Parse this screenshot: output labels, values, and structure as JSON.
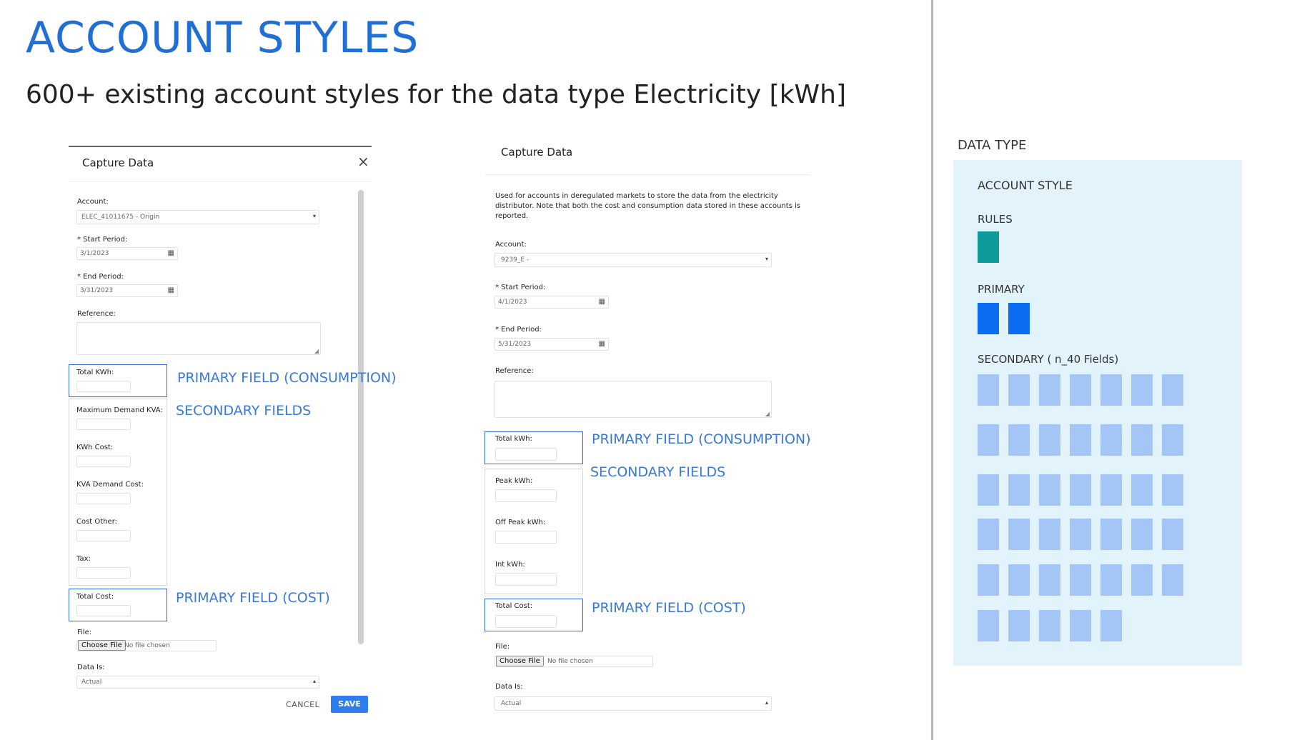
{
  "title": "ACCOUNT STYLES",
  "subtitle": "600+ existing account styles for the data type Electricity [kWh]",
  "left_form": {
    "header": "Capture Data",
    "close": "×",
    "account_label": "Account:",
    "account_value": "ELEC_41011675 - Origin",
    "start_label": "* Start Period:",
    "start_value": "3/1/2023",
    "end_label": "* End Period:",
    "end_value": "3/31/2023",
    "reference_label": "Reference:",
    "primary_field": "Total KWh:",
    "secondary_fields": [
      "Maximum Demand KVA:",
      "KWh Cost:",
      "KVA Demand Cost:",
      "Cost Other:",
      "Tax:"
    ],
    "total_cost_label": "Total Cost:",
    "file_label": "File:",
    "choose_file": "Choose File",
    "no_file": "No file chosen",
    "data_is_label": "Data Is:",
    "data_is_value": "Actual",
    "cancel": "CANCEL",
    "save": "SAVE"
  },
  "right_form": {
    "header": "Capture Data",
    "description": "Used for accounts in deregulated markets to store the data from the electricity distributor. Note that both the cost and consumption data stored in these accounts is reported.",
    "account_label": "Account:",
    "account_value": "9239_E -",
    "start_label": "* Start Period:",
    "start_value": "4/1/2023",
    "end_label": "* End Period:",
    "end_value": "5/31/2023",
    "reference_label": "Reference:",
    "primary_field": "Total kWh:",
    "secondary_fields": [
      "Peak kWh:",
      "Off Peak kWh:",
      "Int kWh:"
    ],
    "total_cost_label": "Total Cost:",
    "file_label": "File:",
    "choose_file": "Choose File",
    "no_file": "No file chosen",
    "data_is_label": "Data Is:",
    "data_is_value": "Actual"
  },
  "annotations": {
    "primary_consumption": "PRIMARY FIELD (CONSUMPTION)",
    "secondary": "SECONDARY FIELDS",
    "primary_cost": "PRIMARY FIELD (COST)"
  },
  "data_type_panel": {
    "heading": "DATA TYPE",
    "account_style": "ACCOUNT STYLE",
    "rules": "RULES",
    "primary": "PRIMARY",
    "secondary": "SECONDARY ( n_40 Fields)",
    "rules_count": 1,
    "primary_count": 2,
    "secondary_rows": [
      7,
      7,
      7,
      7,
      7,
      5
    ]
  },
  "colors": {
    "title": "#1f6fd6",
    "annotation": "#3a78d4",
    "panel_bg": "#e2f3fb",
    "rules_block": "#0e9a9a",
    "primary_block": "#0a6cf0",
    "secondary_block": "#a3c6f7",
    "save_button": "#2f7ef0"
  }
}
